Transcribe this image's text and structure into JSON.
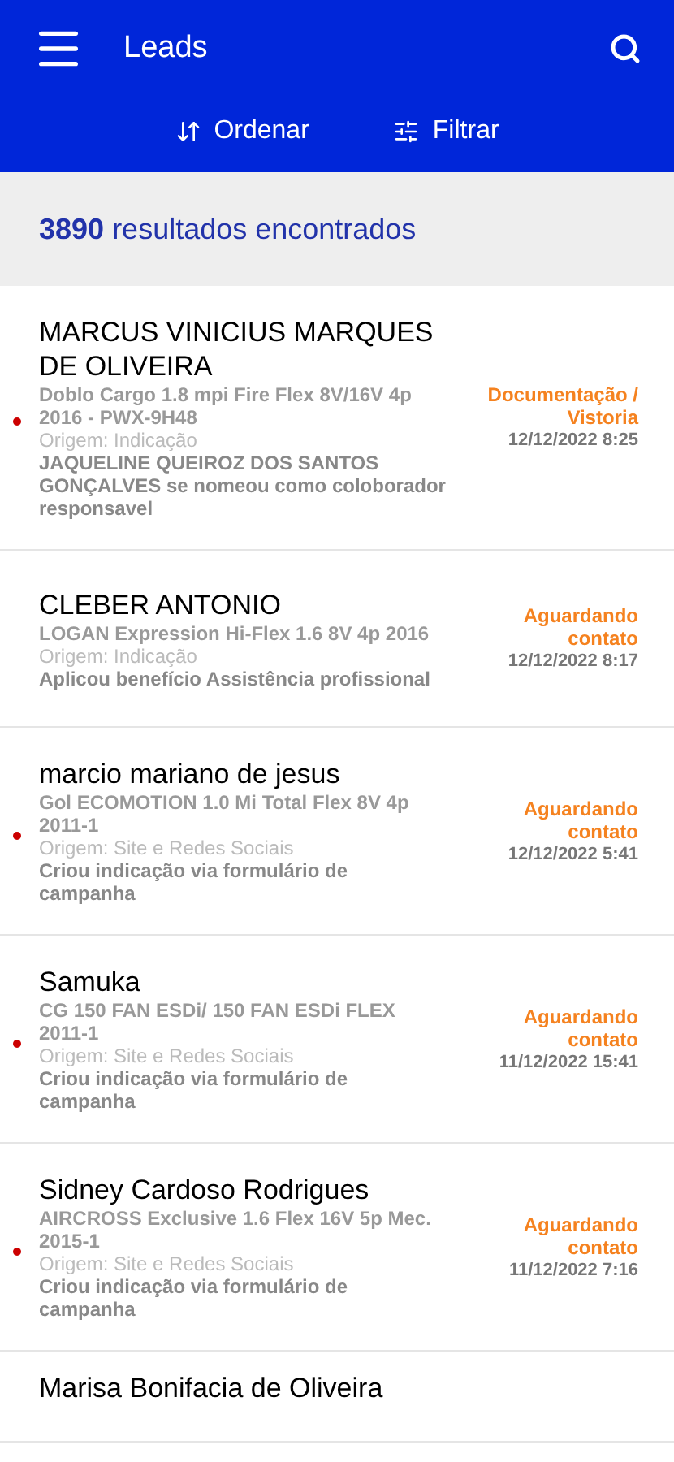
{
  "app_bar": {
    "title": "Leads"
  },
  "actions": [
    {
      "kind": "sort",
      "label": "Ordenar"
    },
    {
      "kind": "filter",
      "label": "Filtrar"
    }
  ],
  "results": {
    "count": "3890",
    "label": "resultados encontrados"
  },
  "leads": [
    {
      "name": "MARCUS VINICIUS MARQUES DE OLIVEIRA",
      "vehicle": "Doblo Cargo 1.8 mpi Fire Flex 8V/16V 4p 2016 - PWX-9H48",
      "origin": "Origem: Indicação",
      "activity": "JAQUELINE QUEIROZ DOS SANTOS GONÇALVES se nomeou como coloborador responsavel",
      "status": "Documentação / Vistoria",
      "date": "12/12/2022 8:25",
      "unread": true
    },
    {
      "name": "CLEBER ANTONIO",
      "vehicle": "LOGAN Expression Hi-Flex 1.6 8V 4p 2016",
      "origin": "Origem: Indicação",
      "activity": "Aplicou benefício Assistência profissional",
      "status": "Aguardando contato",
      "date": "12/12/2022 8:17",
      "unread": false
    },
    {
      "name": "marcio mariano de jesus",
      "vehicle": "Gol ECOMOTION 1.0 Mi Total Flex 8V 4p 2011-1",
      "origin": "Origem: Site e Redes Sociais",
      "activity": "Criou indicação via formulário de campanha",
      "status": "Aguardando contato",
      "date": "12/12/2022 5:41",
      "unread": true
    },
    {
      "name": "Samuka",
      "vehicle": "CG 150 FAN ESDi/ 150 FAN ESDi FLEX 2011-1",
      "origin": "Origem: Site e Redes Sociais",
      "activity": "Criou indicação via formulário de campanha",
      "status": "Aguardando contato",
      "date": "11/12/2022 15:41",
      "unread": true
    },
    {
      "name": "Sidney Cardoso Rodrigues",
      "vehicle": "AIRCROSS Exclusive 1.6 Flex 16V 5p Mec. 2015-1",
      "origin": "Origem: Site e Redes Sociais",
      "activity": "Criou indicação via formulário de campanha",
      "status": "Aguardando contato",
      "date": "11/12/2022 7:16",
      "unread": true
    },
    {
      "name": "Marisa Bonifacia de Oliveira"
    }
  ]
}
